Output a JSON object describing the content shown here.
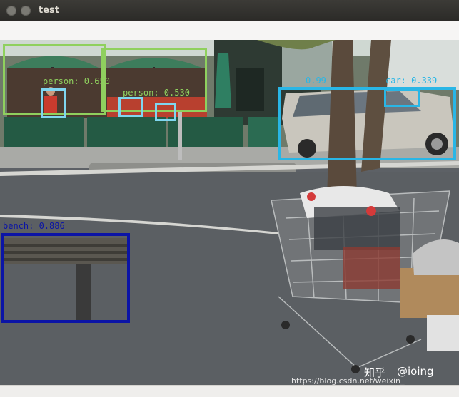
{
  "window": {
    "title": "test"
  },
  "colors": {
    "person": "#8fd05e",
    "person_small": "#7fd6f0",
    "car": "#29b6e6",
    "bench": "#0b14a6"
  },
  "detections": [
    {
      "label": "person: 0.650"
    },
    {
      "label": "person: 0.530"
    },
    {
      "label": "0.99"
    },
    {
      "label": "car: 0.339"
    },
    {
      "label": "bench: 0.886"
    }
  ],
  "watermark": {
    "brand": "知乎",
    "user": "@ioing",
    "url": "https://blog.csdn.net/weixin_"
  }
}
